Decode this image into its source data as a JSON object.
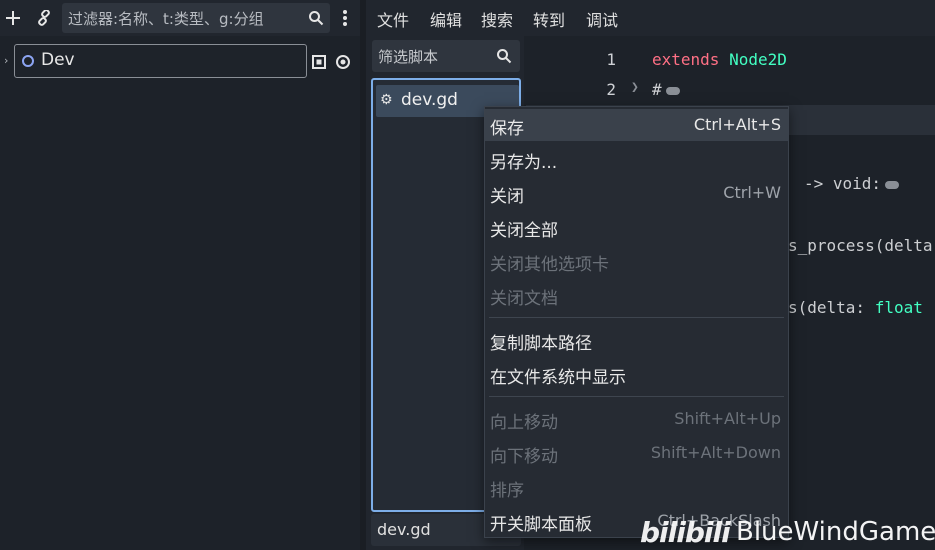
{
  "scene_dock": {
    "filter_placeholder": "过滤器:名称、t:类型、g:分组",
    "tree": [
      {
        "label": "Dev"
      }
    ]
  },
  "menu_bar": {
    "items": [
      "文件",
      "编辑",
      "搜索",
      "转到",
      "调试"
    ]
  },
  "script_panel": {
    "filter_placeholder": "筛选脚本",
    "scripts": [
      {
        "name": "dev.gd"
      }
    ],
    "bottom_label": "dev.gd"
  },
  "code": {
    "lines": [
      {
        "number": "1",
        "keyword": "extends",
        "type": "Node2D"
      },
      {
        "number": "2",
        "text": "#"
      }
    ],
    "fragments": {
      "return_void": "-> void:",
      "process_call": "s_process(delta",
      "delta_param_a": "s(delta: ",
      "delta_param_b": "float"
    }
  },
  "context_menu": {
    "groups": [
      [
        {
          "label": "保存",
          "shortcut": "Ctrl+Alt+S",
          "enabled": true,
          "hover": true
        },
        {
          "label": "另存为...",
          "shortcut": "",
          "enabled": true
        },
        {
          "label": "关闭",
          "shortcut": "Ctrl+W",
          "enabled": true
        },
        {
          "label": "关闭全部",
          "shortcut": "",
          "enabled": true
        },
        {
          "label": "关闭其他选项卡",
          "shortcut": "",
          "enabled": false
        },
        {
          "label": "关闭文档",
          "shortcut": "",
          "enabled": false
        }
      ],
      [
        {
          "label": "复制脚本路径",
          "shortcut": "",
          "enabled": true
        },
        {
          "label": "在文件系统中显示",
          "shortcut": "",
          "enabled": true
        }
      ],
      [
        {
          "label": "向上移动",
          "shortcut": "Shift+Alt+Up",
          "enabled": false
        },
        {
          "label": "向下移动",
          "shortcut": "Shift+Alt+Down",
          "enabled": false
        },
        {
          "label": "排序",
          "shortcut": "",
          "enabled": false
        },
        {
          "label": "开关脚本面板",
          "shortcut": "Ctrl+BackSlash",
          "enabled": true
        }
      ]
    ]
  },
  "watermark": {
    "brand": "bilibili",
    "text": "BlueWindGame"
  },
  "colors": {
    "accent": "#7daee8",
    "keyword": "#ff7085",
    "type": "#42ffc2",
    "node_icon": "#8da5f3"
  },
  "icons": [
    "add-icon",
    "link-icon",
    "search-icon",
    "more-icon",
    "node2d-icon",
    "visibility-toggle-icon",
    "gear-icon",
    "fold-icon"
  ]
}
